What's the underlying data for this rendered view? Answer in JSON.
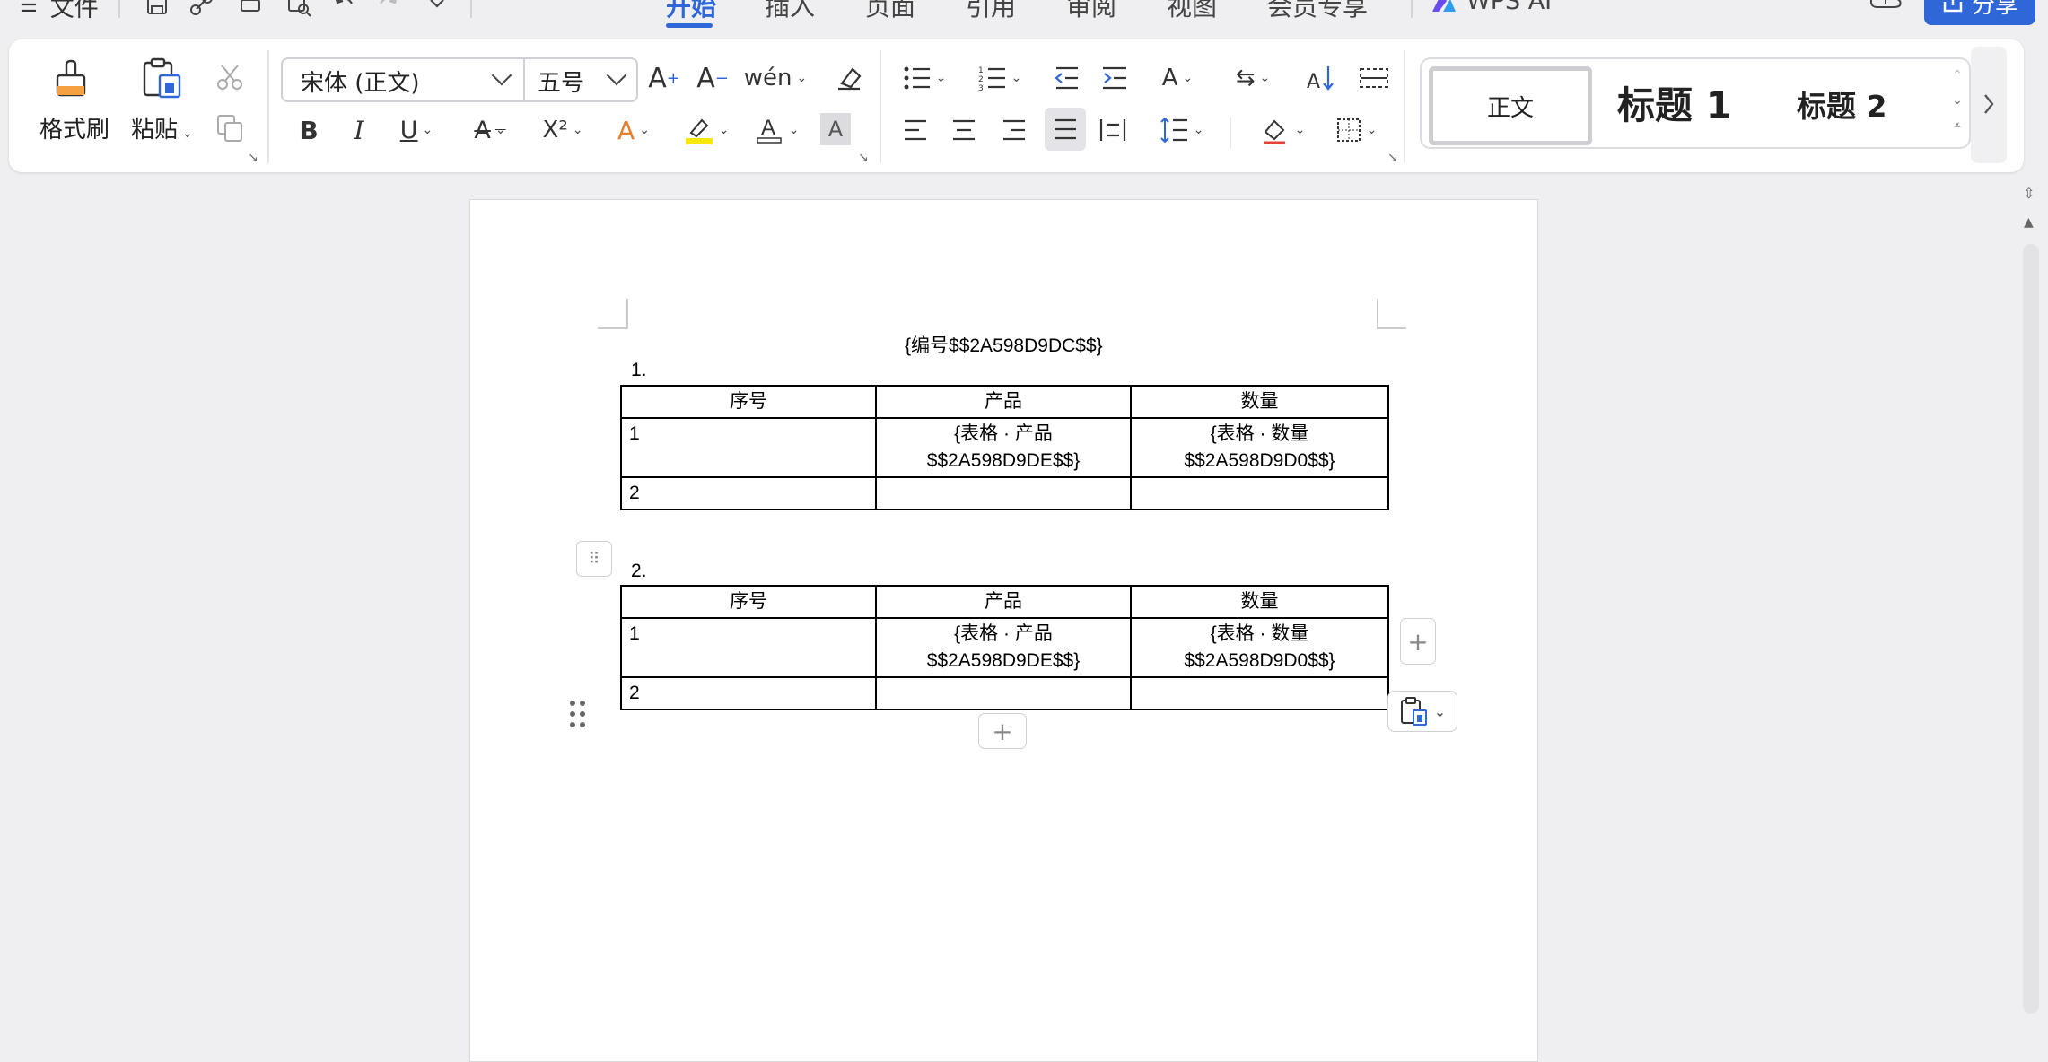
{
  "topbar": {
    "menu_label": "文件",
    "tabs": [
      {
        "label": "开始",
        "active": true
      },
      {
        "label": "插入"
      },
      {
        "label": "页面"
      },
      {
        "label": "引用"
      },
      {
        "label": "审阅"
      },
      {
        "label": "视图"
      },
      {
        "label": "会员专享"
      }
    ],
    "ai_label": "WPS AI",
    "share_label": "分享",
    "accent": "#2f67d8"
  },
  "ribbon": {
    "format_painter_label": "格式刷",
    "paste_label": "粘贴",
    "font_name": "宋体 (正文)",
    "font_size": "五号",
    "bold": "B",
    "italic": "I",
    "underline": "U",
    "superscript": "X²",
    "styles": {
      "normal": "正文",
      "heading1": "标题 1",
      "heading2": "标题 2"
    }
  },
  "document": {
    "header_field": "{编号$$2A598D9DC$$}",
    "list_items": [
      "1.",
      "2."
    ],
    "tables": [
      {
        "headers": [
          "序号",
          "产品",
          "数量"
        ],
        "rows": [
          [
            "1",
            "{表格 · 产品 $$2A598D9DE$$}",
            "{表格 · 数量 $$2A598D9D0$$}"
          ],
          [
            "2",
            "",
            ""
          ]
        ]
      },
      {
        "headers": [
          "序号",
          "产品",
          "数量"
        ],
        "rows": [
          [
            "1",
            "{表格 · 产品 $$2A598D9DE$$}",
            "{表格 · 数量 $$2A598D9D0$$}"
          ],
          [
            "2",
            "",
            ""
          ]
        ]
      }
    ],
    "add_symbol": "+"
  }
}
